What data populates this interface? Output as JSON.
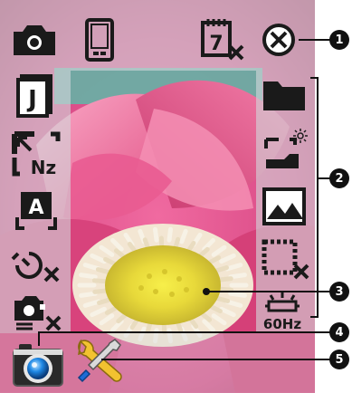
{
  "icons": {
    "left_panel": [
      "camera-mode-icon",
      "jpeg-quality-icon",
      "resolution-icon",
      "auto-mode-icon",
      "self-timer-off-icon",
      "frame-overlay-off-icon"
    ],
    "top_panel": [
      "device-storage-icon",
      "calendar-off-icon",
      "close-icon"
    ],
    "right_panel": [
      "album-folder-icon",
      "brightness-icon",
      "scene-landscape-icon",
      "frame-off-icon",
      "flicker-60hz-icon"
    ],
    "bottom_bar": [
      "shutter-button-icon",
      "settings-tools-icon"
    ]
  },
  "labels": {
    "jpeg": "J",
    "resolution_sub": "Nz",
    "auto": "A",
    "calendar_digit": "7",
    "flicker_hz": "60Hz"
  },
  "callouts": [
    {
      "number": "1",
      "target": "close-button"
    },
    {
      "number": "2",
      "target": "right-settings-panel"
    },
    {
      "number": "3",
      "target": "viewfinder-focus-area"
    },
    {
      "number": "4",
      "target": "shutter-button"
    },
    {
      "number": "5",
      "target": "tools-button"
    }
  ],
  "colors": {
    "icon_dark": "#1a1a1a",
    "panel_overlay": "#d2d7da",
    "shutter_blue": "#1e88e5",
    "wrench_yellow": "#f2c230",
    "callout": "#111111"
  }
}
